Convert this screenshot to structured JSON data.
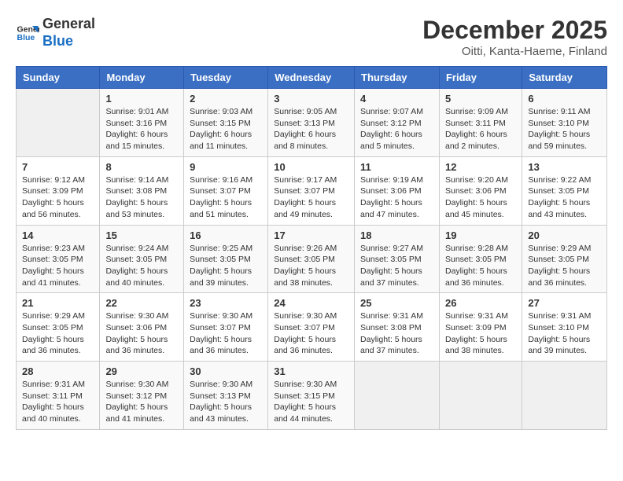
{
  "header": {
    "logo_line1": "General",
    "logo_line2": "Blue",
    "title": "December 2025",
    "subtitle": "Oitti, Kanta-Haeme, Finland"
  },
  "days_of_week": [
    "Sunday",
    "Monday",
    "Tuesday",
    "Wednesday",
    "Thursday",
    "Friday",
    "Saturday"
  ],
  "weeks": [
    [
      {
        "num": "",
        "info": ""
      },
      {
        "num": "1",
        "info": "Sunrise: 9:01 AM\nSunset: 3:16 PM\nDaylight: 6 hours\nand 15 minutes."
      },
      {
        "num": "2",
        "info": "Sunrise: 9:03 AM\nSunset: 3:15 PM\nDaylight: 6 hours\nand 11 minutes."
      },
      {
        "num": "3",
        "info": "Sunrise: 9:05 AM\nSunset: 3:13 PM\nDaylight: 6 hours\nand 8 minutes."
      },
      {
        "num": "4",
        "info": "Sunrise: 9:07 AM\nSunset: 3:12 PM\nDaylight: 6 hours\nand 5 minutes."
      },
      {
        "num": "5",
        "info": "Sunrise: 9:09 AM\nSunset: 3:11 PM\nDaylight: 6 hours\nand 2 minutes."
      },
      {
        "num": "6",
        "info": "Sunrise: 9:11 AM\nSunset: 3:10 PM\nDaylight: 5 hours\nand 59 minutes."
      }
    ],
    [
      {
        "num": "7",
        "info": "Sunrise: 9:12 AM\nSunset: 3:09 PM\nDaylight: 5 hours\nand 56 minutes."
      },
      {
        "num": "8",
        "info": "Sunrise: 9:14 AM\nSunset: 3:08 PM\nDaylight: 5 hours\nand 53 minutes."
      },
      {
        "num": "9",
        "info": "Sunrise: 9:16 AM\nSunset: 3:07 PM\nDaylight: 5 hours\nand 51 minutes."
      },
      {
        "num": "10",
        "info": "Sunrise: 9:17 AM\nSunset: 3:07 PM\nDaylight: 5 hours\nand 49 minutes."
      },
      {
        "num": "11",
        "info": "Sunrise: 9:19 AM\nSunset: 3:06 PM\nDaylight: 5 hours\nand 47 minutes."
      },
      {
        "num": "12",
        "info": "Sunrise: 9:20 AM\nSunset: 3:06 PM\nDaylight: 5 hours\nand 45 minutes."
      },
      {
        "num": "13",
        "info": "Sunrise: 9:22 AM\nSunset: 3:05 PM\nDaylight: 5 hours\nand 43 minutes."
      }
    ],
    [
      {
        "num": "14",
        "info": "Sunrise: 9:23 AM\nSunset: 3:05 PM\nDaylight: 5 hours\nand 41 minutes."
      },
      {
        "num": "15",
        "info": "Sunrise: 9:24 AM\nSunset: 3:05 PM\nDaylight: 5 hours\nand 40 minutes."
      },
      {
        "num": "16",
        "info": "Sunrise: 9:25 AM\nSunset: 3:05 PM\nDaylight: 5 hours\nand 39 minutes."
      },
      {
        "num": "17",
        "info": "Sunrise: 9:26 AM\nSunset: 3:05 PM\nDaylight: 5 hours\nand 38 minutes."
      },
      {
        "num": "18",
        "info": "Sunrise: 9:27 AM\nSunset: 3:05 PM\nDaylight: 5 hours\nand 37 minutes."
      },
      {
        "num": "19",
        "info": "Sunrise: 9:28 AM\nSunset: 3:05 PM\nDaylight: 5 hours\nand 36 minutes."
      },
      {
        "num": "20",
        "info": "Sunrise: 9:29 AM\nSunset: 3:05 PM\nDaylight: 5 hours\nand 36 minutes."
      }
    ],
    [
      {
        "num": "21",
        "info": "Sunrise: 9:29 AM\nSunset: 3:05 PM\nDaylight: 5 hours\nand 36 minutes."
      },
      {
        "num": "22",
        "info": "Sunrise: 9:30 AM\nSunset: 3:06 PM\nDaylight: 5 hours\nand 36 minutes."
      },
      {
        "num": "23",
        "info": "Sunrise: 9:30 AM\nSunset: 3:07 PM\nDaylight: 5 hours\nand 36 minutes."
      },
      {
        "num": "24",
        "info": "Sunrise: 9:30 AM\nSunset: 3:07 PM\nDaylight: 5 hours\nand 36 minutes."
      },
      {
        "num": "25",
        "info": "Sunrise: 9:31 AM\nSunset: 3:08 PM\nDaylight: 5 hours\nand 37 minutes."
      },
      {
        "num": "26",
        "info": "Sunrise: 9:31 AM\nSunset: 3:09 PM\nDaylight: 5 hours\nand 38 minutes."
      },
      {
        "num": "27",
        "info": "Sunrise: 9:31 AM\nSunset: 3:10 PM\nDaylight: 5 hours\nand 39 minutes."
      }
    ],
    [
      {
        "num": "28",
        "info": "Sunrise: 9:31 AM\nSunset: 3:11 PM\nDaylight: 5 hours\nand 40 minutes."
      },
      {
        "num": "29",
        "info": "Sunrise: 9:30 AM\nSunset: 3:12 PM\nDaylight: 5 hours\nand 41 minutes."
      },
      {
        "num": "30",
        "info": "Sunrise: 9:30 AM\nSunset: 3:13 PM\nDaylight: 5 hours\nand 43 minutes."
      },
      {
        "num": "31",
        "info": "Sunrise: 9:30 AM\nSunset: 3:15 PM\nDaylight: 5 hours\nand 44 minutes."
      },
      {
        "num": "",
        "info": ""
      },
      {
        "num": "",
        "info": ""
      },
      {
        "num": "",
        "info": ""
      }
    ]
  ]
}
